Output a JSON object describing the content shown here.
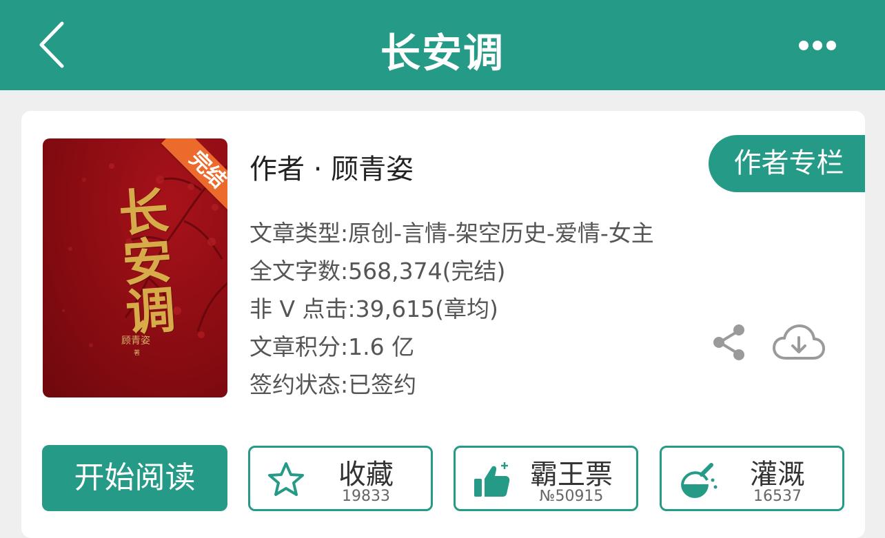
{
  "header": {
    "title": "长安调"
  },
  "book": {
    "cover": {
      "title_art": "长安调",
      "author_small": "顾青姿",
      "zhu_mark": "著",
      "ribbon": "完结"
    },
    "author_line": "作者 · 顾青姿",
    "author_column_button": "作者专栏",
    "info": [
      "文章类型:原创-言情-架空历史-爱情-女主",
      "全文字数:568,374(完结)",
      "非 V 点击:39,615(章均)",
      "文章积分:1.6 亿",
      "签约状态:已签约"
    ]
  },
  "actions": {
    "read_button": "开始阅读",
    "favorite": {
      "label": "收藏",
      "count": "19833",
      "icon": "star-icon"
    },
    "vote": {
      "label": "霸王票",
      "count": "№50915",
      "icon": "thumbs-up-icon"
    },
    "water": {
      "label": "灌溉",
      "count": "16537",
      "icon": "watering-flask-icon"
    }
  },
  "colors": {
    "brand": "#259a86",
    "ribbon": "#ec6a2c",
    "cover_red": "#8e0d13",
    "cover_gold": "#d7ab4a"
  }
}
